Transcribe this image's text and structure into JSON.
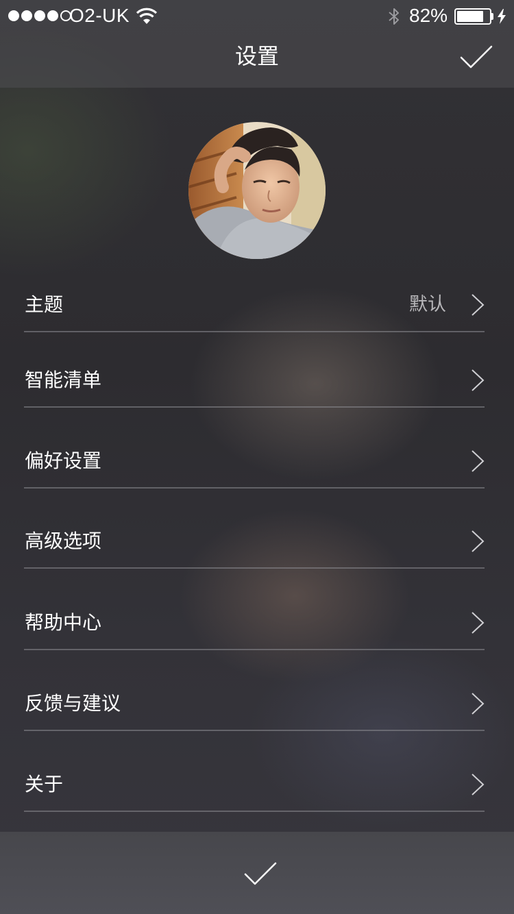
{
  "status_bar": {
    "carrier": "O2-UK",
    "signal_bars_filled": 4,
    "signal_bars_total": 5,
    "battery_percent": "82%",
    "battery_level": 0.82,
    "icons": [
      "wifi-icon",
      "bluetooth-icon",
      "battery-icon",
      "charging-bolt-icon"
    ]
  },
  "header": {
    "title": "设置",
    "confirm_icon": "checkmark-icon"
  },
  "profile": {
    "avatar": "user-avatar-photo"
  },
  "menu": {
    "items": [
      {
        "label": "主题",
        "value": "默认"
      },
      {
        "label": "智能清单",
        "value": ""
      },
      {
        "label": "偏好设置",
        "value": ""
      },
      {
        "label": "高级选项",
        "value": ""
      },
      {
        "label": "帮助中心",
        "value": ""
      },
      {
        "label": "反馈与建议",
        "value": ""
      },
      {
        "label": "关于",
        "value": ""
      }
    ],
    "chevron_icon": "chevron-right-icon"
  },
  "bottom_bar": {
    "confirm_icon": "checkmark-icon"
  },
  "colors": {
    "text_primary": "#ffffff",
    "text_secondary": "#b7b6b9",
    "divider": "#8c8c92",
    "header_bg": "#4e4e52",
    "bottom_bar_bg": "#4b4b51"
  }
}
